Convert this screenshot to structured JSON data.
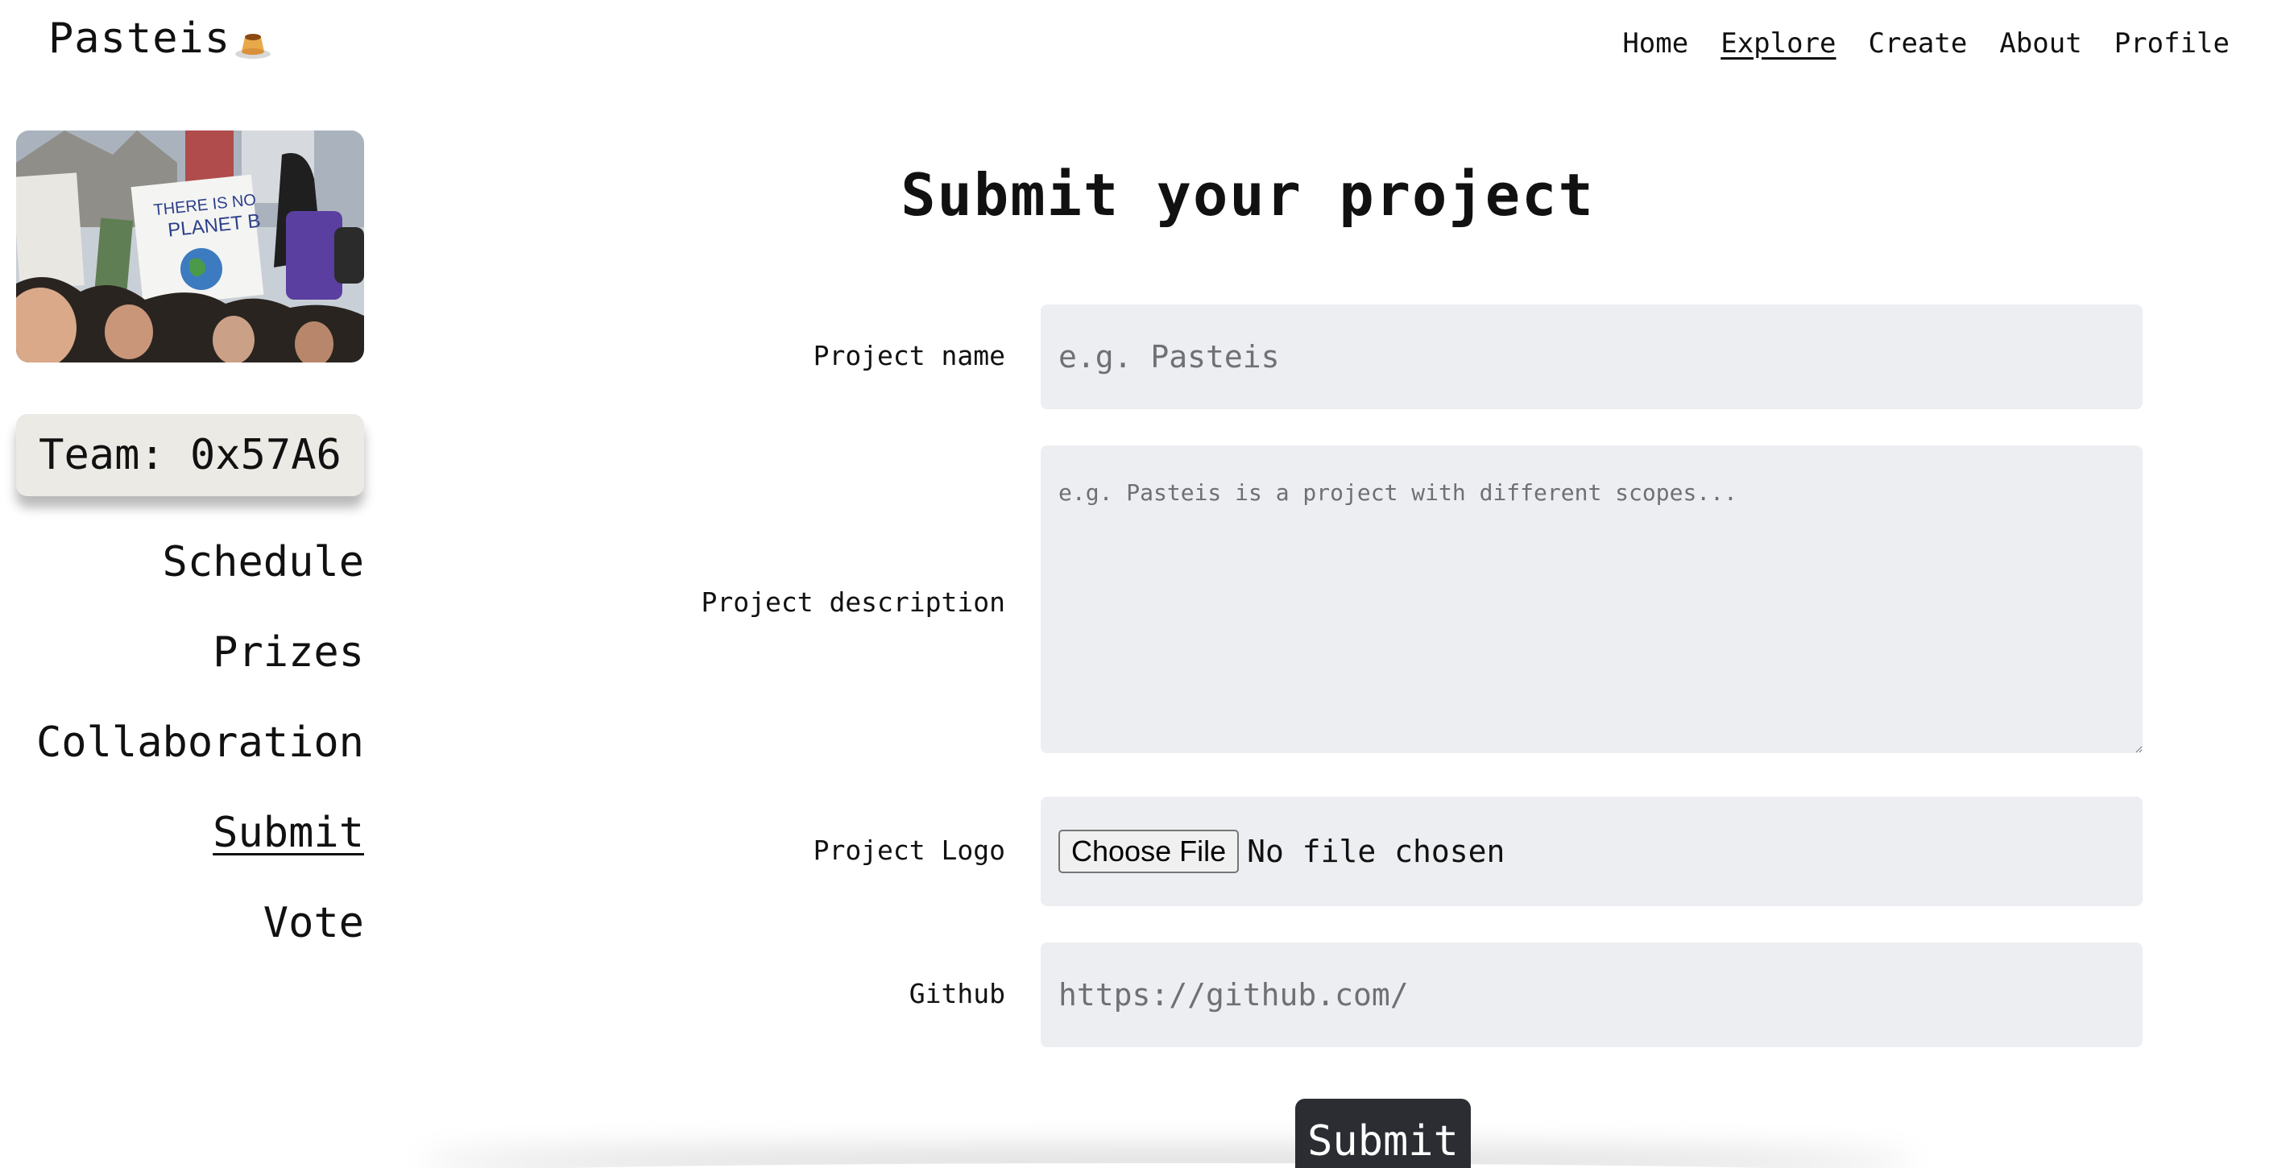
{
  "header": {
    "brand": "Pasteis",
    "brand_icon": "flan-icon",
    "nav": [
      {
        "label": "Home",
        "active": false
      },
      {
        "label": "Explore",
        "active": true
      },
      {
        "label": "Create",
        "active": false
      },
      {
        "label": "About",
        "active": false
      },
      {
        "label": "Profile",
        "active": false
      }
    ]
  },
  "sidebar": {
    "image_alt": "Protest crowd photo",
    "image_sign_text": "THERE IS NO PLANET B",
    "team": "Team: 0x57A6",
    "menu": [
      {
        "label": "Schedule",
        "active": false
      },
      {
        "label": "Prizes",
        "active": false
      },
      {
        "label": "Collaboration",
        "active": false
      },
      {
        "label": "Submit",
        "active": true
      },
      {
        "label": "Vote",
        "active": false
      }
    ]
  },
  "form": {
    "title": "Submit your project",
    "project_name": {
      "label": "Project name",
      "value": "",
      "placeholder": "e.g. Pasteis"
    },
    "project_description": {
      "label": "Project description",
      "value": "",
      "placeholder": "e.g. Pasteis is a project with different scopes..."
    },
    "project_logo": {
      "label": "Project Logo",
      "button": "Choose File",
      "status": "No file chosen"
    },
    "github": {
      "label": "Github",
      "value": "",
      "placeholder": "https://github.com/"
    },
    "submit_label": "Submit"
  },
  "colors": {
    "field_bg": "#edeef1",
    "team_badge_bg": "#ebeae5",
    "submit_bg": "#2b2d33"
  }
}
